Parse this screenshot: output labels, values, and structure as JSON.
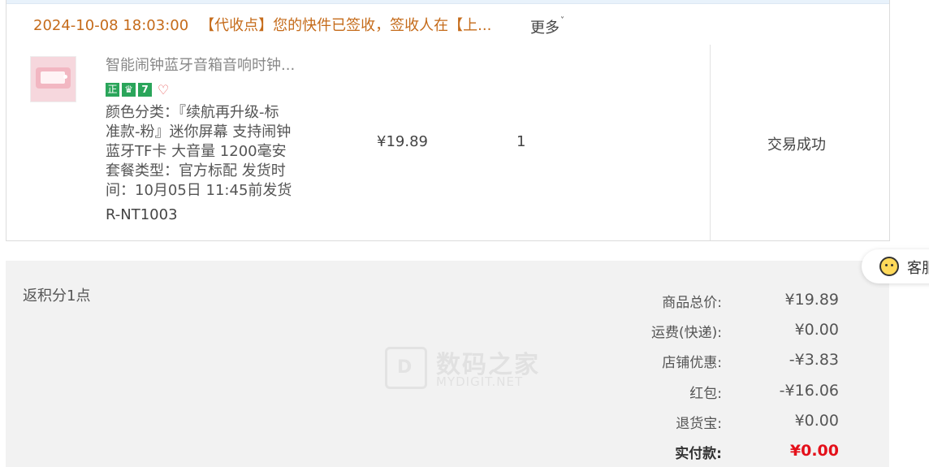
{
  "order": {
    "logistics": {
      "timestamp": "2024-10-08 18:03:00",
      "message": "【代收点】您的快件已签收，签收人在【上...",
      "more_label": "更多",
      "more_caret": "˅"
    },
    "item": {
      "title": "智能闹钟蓝牙音箱音响时钟...",
      "badges": [
        "正",
        "♛",
        "7",
        "♡"
      ],
      "sku_lines": [
        "颜色分类：『续航再升级-标",
        "准款-粉』迷你屏幕 支持闹钟",
        "蓝牙TF卡 大音量 1200毫安",
        "套餐类型：官方标配 发货时",
        "间：10月05日 11:45前发货"
      ],
      "sku_id": "R-NT1003",
      "price": "¥19.89",
      "quantity": "1",
      "status": "交易成功"
    }
  },
  "summary": {
    "points": "返积分1点",
    "rows": [
      {
        "label": "商品总价:",
        "value": "¥19.89"
      },
      {
        "label": "运费(快递):",
        "value": "¥0.00"
      },
      {
        "label": "店铺优惠:",
        "value": "-¥3.83"
      },
      {
        "label": "红包:",
        "value": "-¥16.06"
      },
      {
        "label": "退货宝:",
        "value": "¥0.00"
      }
    ],
    "total": {
      "label": "实付款:",
      "value": "¥0.00"
    }
  },
  "watermark": {
    "cn": "数码之家",
    "en": "MYDIGIT.NET",
    "logo_letter": "D"
  },
  "service": {
    "label": "客服",
    "icon": "bee-face-icon"
  },
  "colors": {
    "logistics_text": "#c56b1a",
    "total_red": "#e4101a",
    "summary_bg": "#f2f2f2",
    "badge_green": "#2aa55a"
  }
}
